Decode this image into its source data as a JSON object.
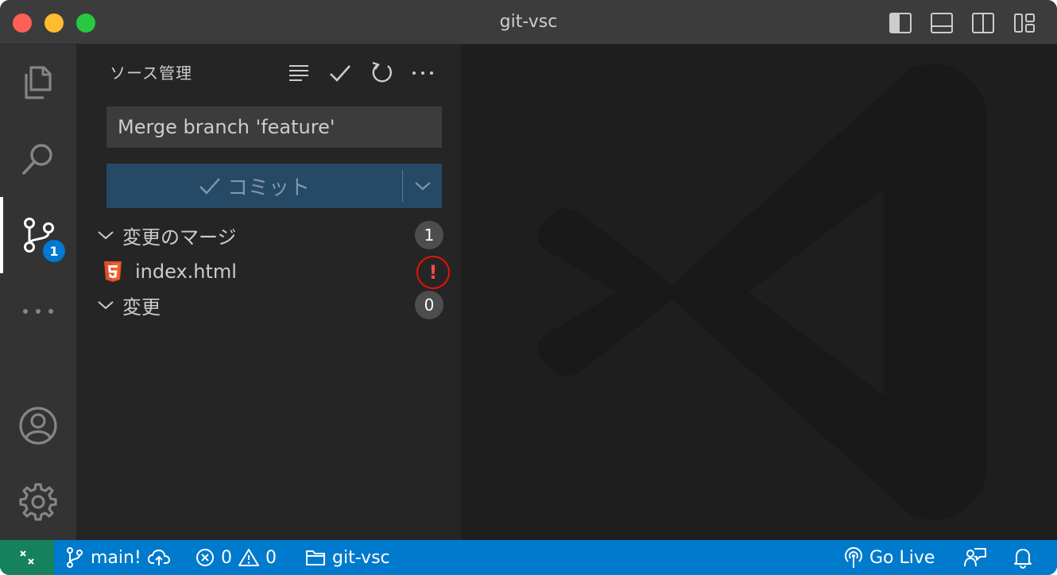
{
  "window": {
    "title": "git-vsc"
  },
  "activity_bar": {
    "items": [
      {
        "icon": "files-icon"
      },
      {
        "icon": "search-icon"
      },
      {
        "icon": "source-control-icon",
        "badge": "1",
        "active": true
      },
      {
        "icon": "more-icon"
      },
      {
        "icon": "account-icon"
      },
      {
        "icon": "settings-gear-icon"
      }
    ]
  },
  "sidebar": {
    "title": "ソース管理",
    "commit_message": {
      "value": "Merge branch 'feature'"
    },
    "commit_button": {
      "label": "コミット"
    },
    "groups": [
      {
        "label": "変更のマージ",
        "count": "1",
        "files": [
          {
            "name": "index.html",
            "status": "!"
          }
        ]
      },
      {
        "label": "変更",
        "count": "0",
        "files": []
      }
    ]
  },
  "statusbar": {
    "branch": "main!",
    "errors": "0",
    "warnings": "0",
    "folder": "git-vsc",
    "go_live": "Go Live"
  },
  "colors": {
    "accent": "#007acc",
    "remote": "#16825d",
    "commit_button": "#264966",
    "conflict": "#e51400"
  }
}
